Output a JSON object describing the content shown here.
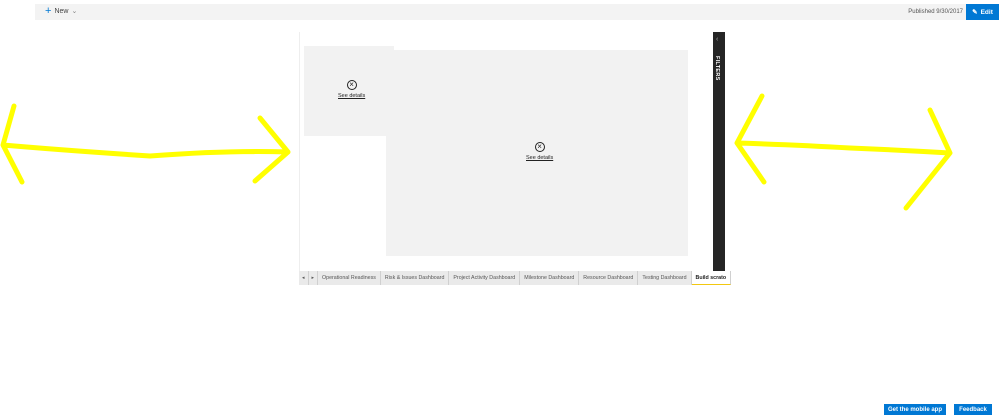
{
  "toolbar": {
    "new_label": "New",
    "published": "Published 9/30/2017",
    "edit_label": "Edit"
  },
  "tiles": [
    {
      "error_link": "See details"
    },
    {
      "error_link": "See details"
    }
  ],
  "filters": {
    "label": "FILTERS",
    "collapse_icon": "chevron-left"
  },
  "tabs": [
    "Operational Readiness",
    "Risk & Issues Dashboard",
    "Project Activity Dashboard",
    "Milestone Dashboard",
    "Resource Dashboard",
    "Testing Dashboard",
    "Build scrato"
  ],
  "footer": {
    "mobile_app": "Get the mobile app",
    "feedback": "Feedback"
  },
  "colors": {
    "accent": "#0078d4",
    "annotation": "#ffff00",
    "filters_bg": "#252525"
  }
}
